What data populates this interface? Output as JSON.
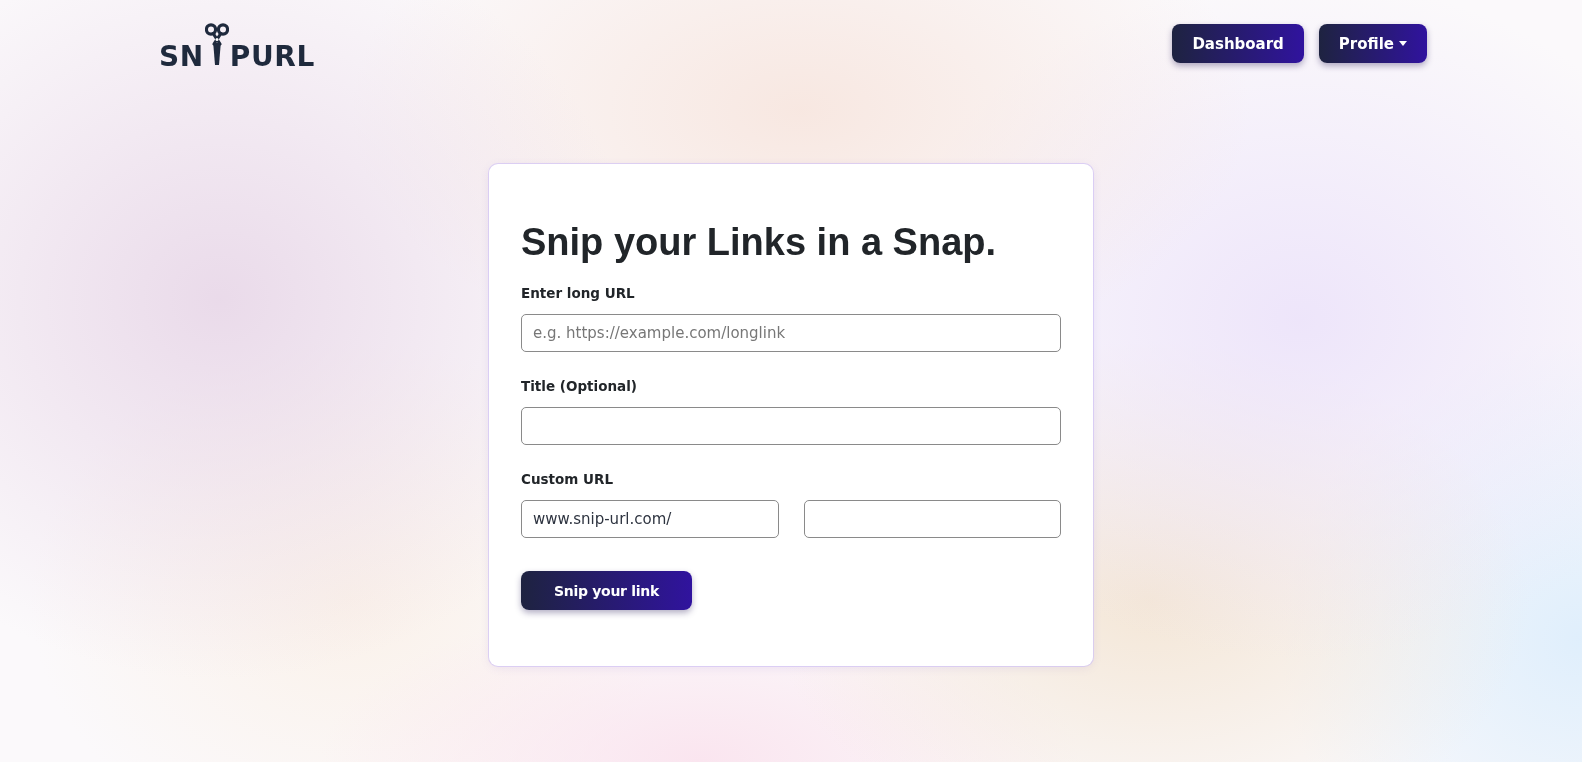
{
  "header": {
    "logo": {
      "text_start": "SN",
      "text_end": "PURL"
    },
    "nav": [
      {
        "label": "Dashboard",
        "kind": "button"
      },
      {
        "label": "Profile",
        "kind": "dropdown"
      }
    ]
  },
  "form": {
    "heading": "Snip your Links in a Snap.",
    "fields": [
      {
        "label": "Enter long URL",
        "placeholder": "e.g. https://example.com/longlink"
      },
      {
        "label": "Title (Optional)"
      }
    ],
    "custom_url": {
      "label": "Custom URL",
      "prefix": "www.snip-url.com/"
    },
    "submit": "Snip your link"
  }
}
